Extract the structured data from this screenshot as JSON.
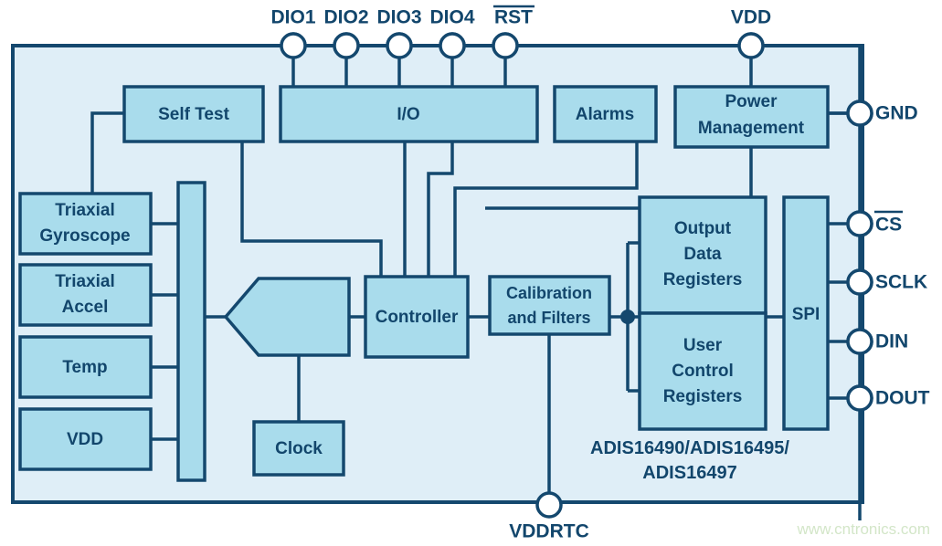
{
  "diagram": {
    "title": "ADIS16490/ADIS16495/ADIS16497 Functional Block Diagram",
    "part_number_line1": "ADIS16490/ADIS16495/",
    "part_number_line2": "ADIS16497",
    "watermark": "www.cntronics.com",
    "colors": {
      "chip_fill": "#DFEEF7",
      "block_fill": "#A9DCEC",
      "line": "#14486E",
      "text": "#12466C",
      "pin_fill": "#FFFFFF",
      "watermark": "#D3E6C8",
      "page_background": "#FFFFFF"
    }
  },
  "pins": {
    "top": [
      {
        "id": "dio1",
        "label": "DIO1",
        "overbar": false
      },
      {
        "id": "dio2",
        "label": "DIO2",
        "overbar": false
      },
      {
        "id": "dio3",
        "label": "DIO3",
        "overbar": false
      },
      {
        "id": "dio4",
        "label": "DIO4",
        "overbar": false
      },
      {
        "id": "rst",
        "label": "RST",
        "overbar": true
      },
      {
        "id": "vdd",
        "label": "VDD",
        "overbar": false
      }
    ],
    "right": [
      {
        "id": "gnd",
        "label": "GND",
        "overbar": false
      },
      {
        "id": "cs",
        "label": "CS",
        "overbar": true
      },
      {
        "id": "sclk",
        "label": "SCLK",
        "overbar": false
      },
      {
        "id": "din",
        "label": "DIN",
        "overbar": false
      },
      {
        "id": "dout",
        "label": "DOUT",
        "overbar": false
      }
    ],
    "bottom": [
      {
        "id": "vddrtc",
        "label": "VDDRTC",
        "overbar": false
      }
    ]
  },
  "blocks": {
    "self_test": {
      "label": "Self Test"
    },
    "io": {
      "label": "I/O"
    },
    "alarms": {
      "label": "Alarms"
    },
    "power_management": {
      "label_line1": "Power",
      "label_line2": "Management"
    },
    "triaxial_gyroscope": {
      "label_line1": "Triaxial",
      "label_line2": "Gyroscope"
    },
    "triaxial_accel": {
      "label_line1": "Triaxial",
      "label_line2": "Accel"
    },
    "temp": {
      "label": "Temp"
    },
    "vdd_sensor": {
      "label": "VDD"
    },
    "adc_bus": {
      "label": ""
    },
    "mux": {
      "label": ""
    },
    "controller": {
      "label": "Controller"
    },
    "clock": {
      "label": "Clock"
    },
    "calibration": {
      "label_line1": "Calibration",
      "label_line2": "and Filters"
    },
    "output_data_registers": {
      "label_line1": "Output",
      "label_line2": "Data",
      "label_line3": "Registers"
    },
    "user_control_registers": {
      "label_line1": "User",
      "label_line2": "Control",
      "label_line3": "Registers"
    },
    "spi": {
      "label": "SPI"
    }
  }
}
